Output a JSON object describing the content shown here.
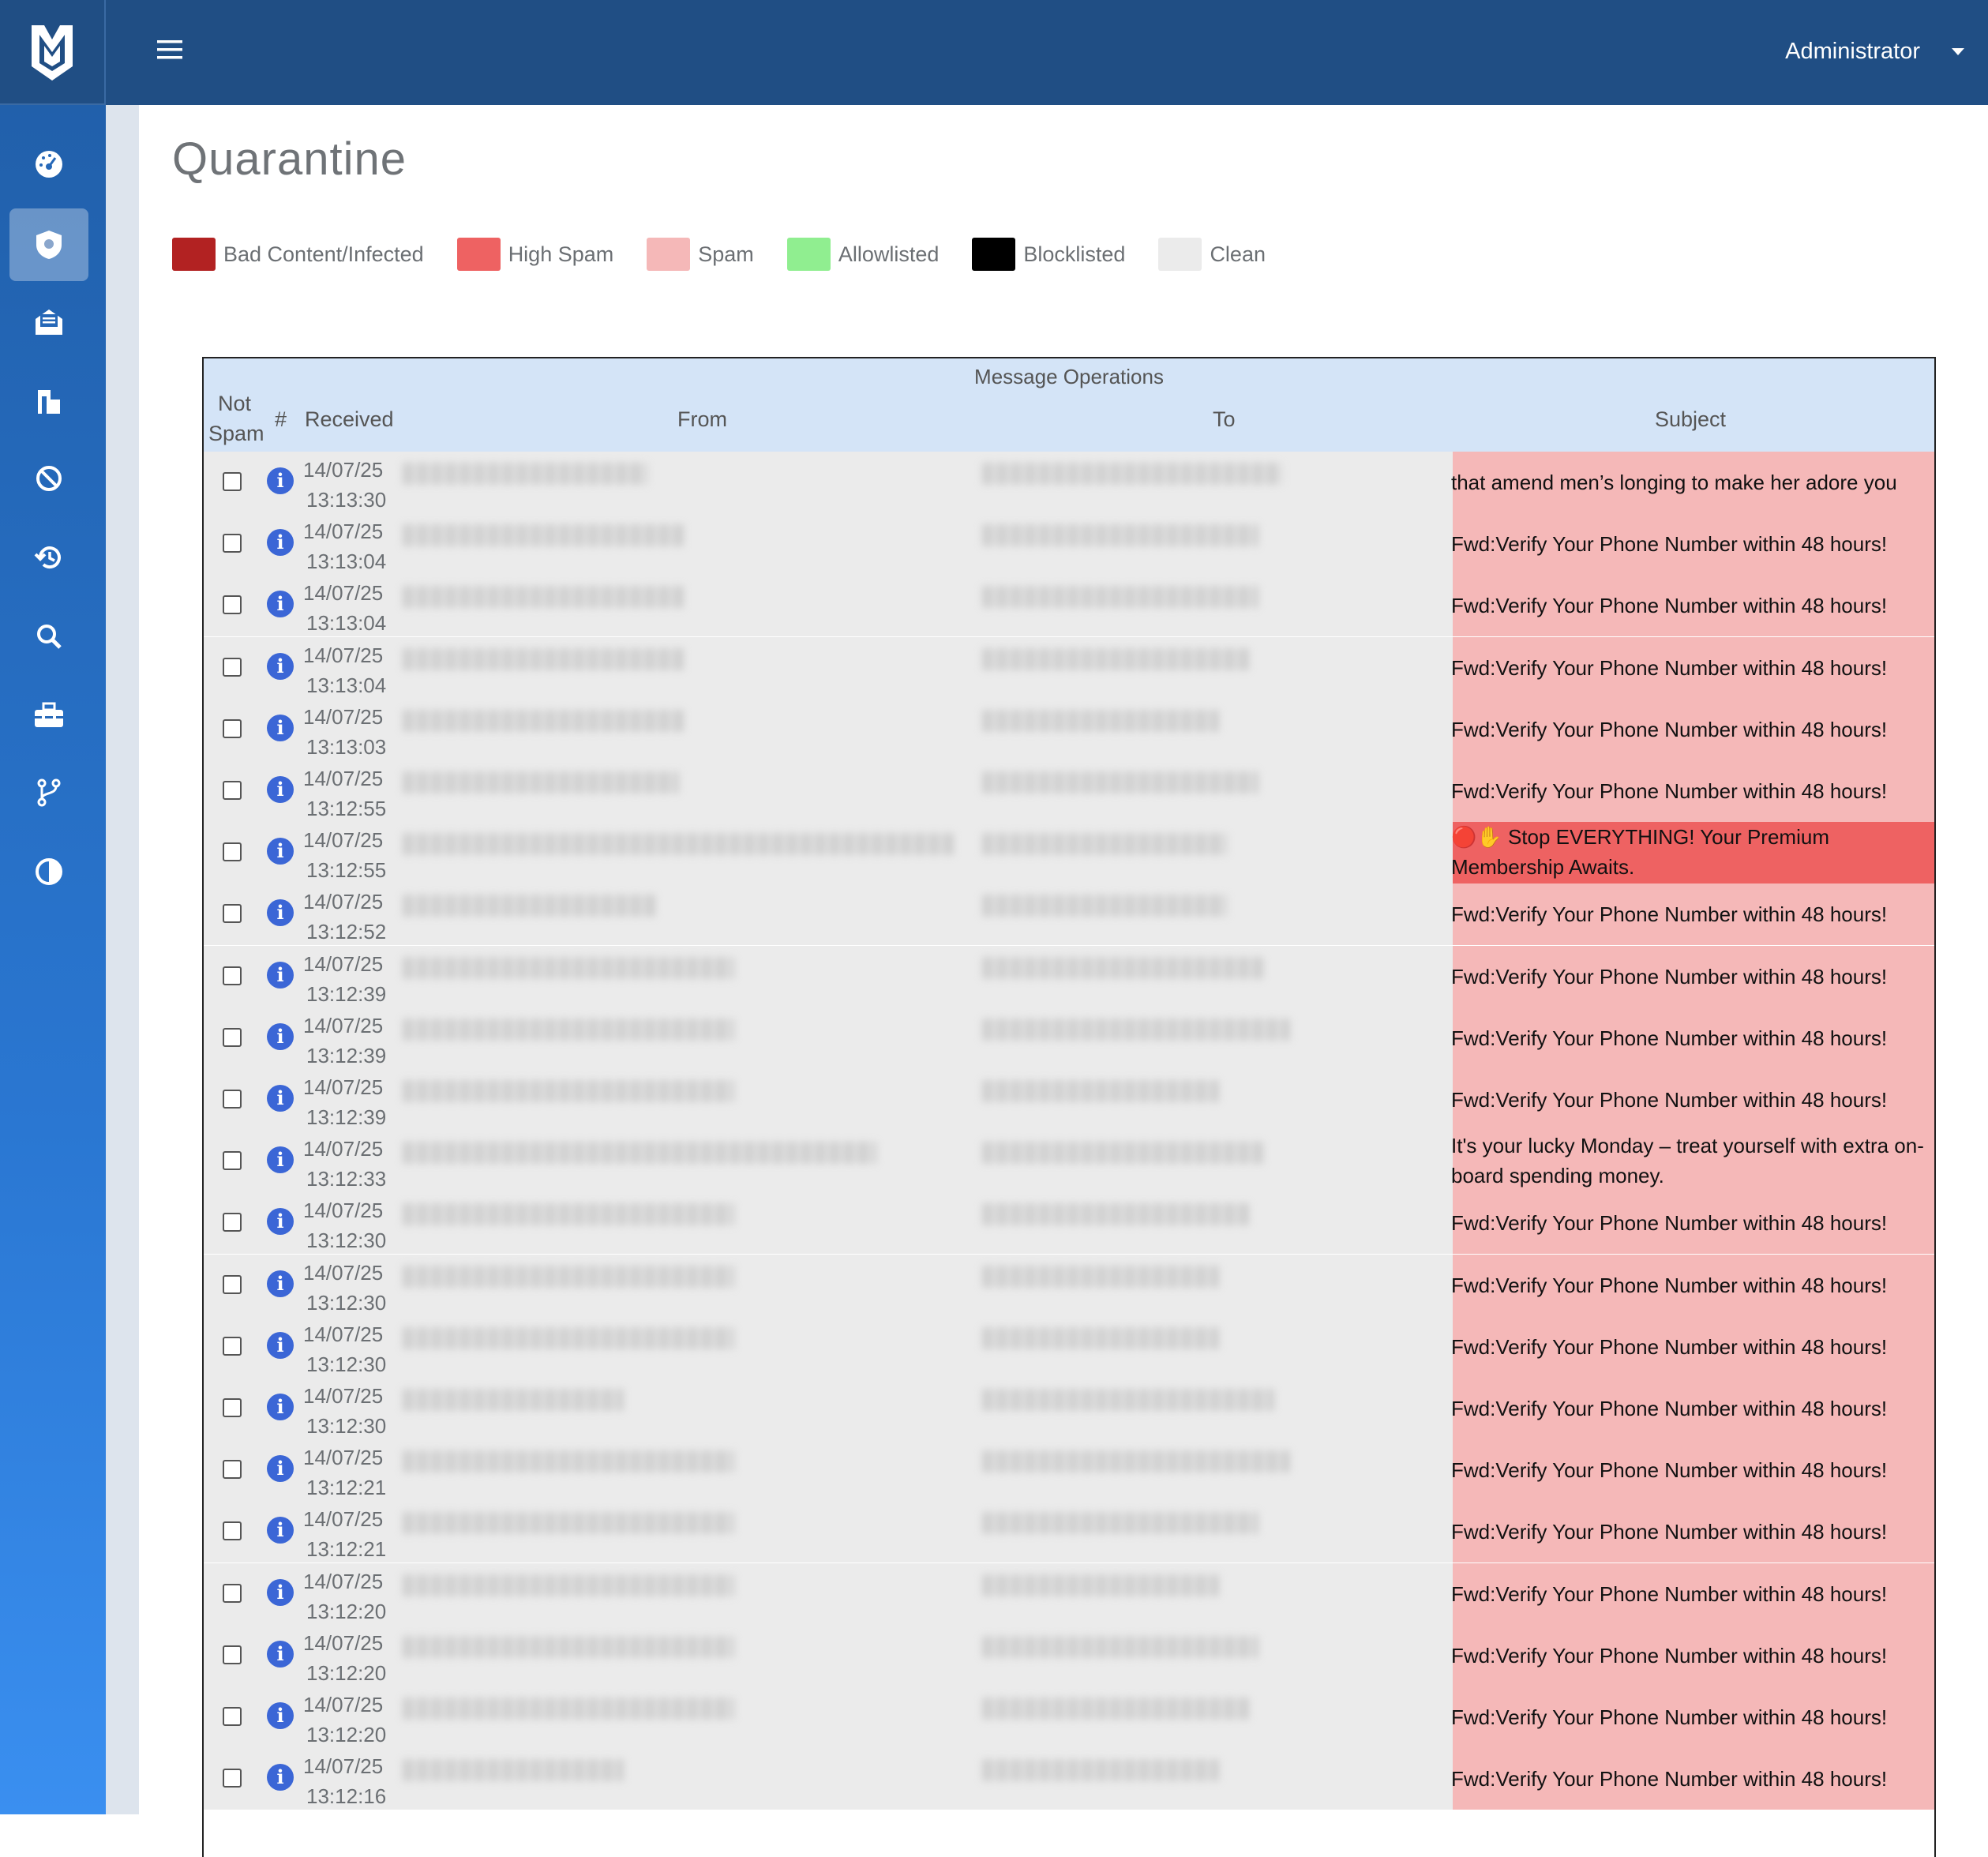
{
  "header": {
    "logo": "mailwatch-logo",
    "menu_icon": "hamburger-menu-icon",
    "user": "Administrator"
  },
  "sidebar": {
    "items": [
      {
        "icon": "dashboard-icon",
        "active": false
      },
      {
        "icon": "shield-icon",
        "active": true
      },
      {
        "icon": "mail-icon",
        "active": false
      },
      {
        "icon": "reports-icon",
        "active": false
      },
      {
        "icon": "block-icon",
        "active": false
      },
      {
        "icon": "history-icon",
        "active": false
      },
      {
        "icon": "search-icon",
        "active": false
      },
      {
        "icon": "toolbox-icon",
        "active": false
      },
      {
        "icon": "branch-icon",
        "active": false
      },
      {
        "icon": "contrast-icon",
        "active": false
      }
    ]
  },
  "page": {
    "title": "Quarantine"
  },
  "legend": [
    {
      "label": "Bad Content/Infected",
      "color": "#b22222"
    },
    {
      "label": "High Spam",
      "color": "#ee6262"
    },
    {
      "label": "Spam",
      "color": "#f5b8b8"
    },
    {
      "label": "Allowlisted",
      "color": "#90ee90"
    },
    {
      "label": "Blocklisted",
      "color": "#000000"
    },
    {
      "label": "Clean",
      "color": "#ebebeb"
    }
  ],
  "table": {
    "group_header": "Message Operations",
    "columns": {
      "not_spam_1": "Not",
      "not_spam_2": "Spam",
      "hash": "#",
      "received": "Received",
      "from": "From",
      "to": "To",
      "subject": "Subject"
    },
    "colors": {
      "spam": "#f5b8b8",
      "high_spam": "#ee6262"
    },
    "rows": [
      {
        "date": "14/07/25",
        "time": "13:13:30",
        "subject": "that amend men’s longing to make her adore you",
        "level": "spam"
      },
      {
        "date": "14/07/25",
        "time": "13:13:04",
        "subject": "Fwd:Verify Your Phone Number within 48 hours!",
        "level": "spam"
      },
      {
        "date": "14/07/25",
        "time": "13:13:04",
        "subject": "Fwd:Verify Your Phone Number within 48 hours!",
        "level": "spam"
      },
      {
        "date": "14/07/25",
        "time": "13:13:04",
        "subject": "Fwd:Verify Your Phone Number within 48 hours!",
        "level": "spam"
      },
      {
        "date": "14/07/25",
        "time": "13:13:03",
        "subject": "Fwd:Verify Your Phone Number within 48 hours!",
        "level": "spam"
      },
      {
        "date": "14/07/25",
        "time": "13:12:55",
        "subject": "Fwd:Verify Your Phone Number within 48 hours!",
        "level": "spam"
      },
      {
        "date": "14/07/25",
        "time": "13:12:55",
        "subject": "🔴✋ Stop EVERYTHING! Your Premium Membership Awaits.",
        "level": "high_spam"
      },
      {
        "date": "14/07/25",
        "time": "13:12:52",
        "subject": "Fwd:Verify Your Phone Number within 48 hours!",
        "level": "spam"
      },
      {
        "date": "14/07/25",
        "time": "13:12:39",
        "subject": "Fwd:Verify Your Phone Number within 48 hours!",
        "level": "spam"
      },
      {
        "date": "14/07/25",
        "time": "13:12:39",
        "subject": "Fwd:Verify Your Phone Number within 48 hours!",
        "level": "spam"
      },
      {
        "date": "14/07/25",
        "time": "13:12:39",
        "subject": "Fwd:Verify Your Phone Number within 48 hours!",
        "level": "spam"
      },
      {
        "date": "14/07/25",
        "time": "13:12:33",
        "subject": "It's your lucky Monday – treat yourself with extra on-board spending money.",
        "level": "spam"
      },
      {
        "date": "14/07/25",
        "time": "13:12:30",
        "subject": "Fwd:Verify Your Phone Number within 48 hours!",
        "level": "spam"
      },
      {
        "date": "14/07/25",
        "time": "13:12:30",
        "subject": "Fwd:Verify Your Phone Number within 48 hours!",
        "level": "spam"
      },
      {
        "date": "14/07/25",
        "time": "13:12:30",
        "subject": "Fwd:Verify Your Phone Number within 48 hours!",
        "level": "spam"
      },
      {
        "date": "14/07/25",
        "time": "13:12:30",
        "subject": "Fwd:Verify Your Phone Number within 48 hours!",
        "level": "spam"
      },
      {
        "date": "14/07/25",
        "time": "13:12:21",
        "subject": "Fwd:Verify Your Phone Number within 48 hours!",
        "level": "spam"
      },
      {
        "date": "14/07/25",
        "time": "13:12:21",
        "subject": "Fwd:Verify Your Phone Number within 48 hours!",
        "level": "spam"
      },
      {
        "date": "14/07/25",
        "time": "13:12:20",
        "subject": "Fwd:Verify Your Phone Number within 48 hours!",
        "level": "spam"
      },
      {
        "date": "14/07/25",
        "time": "13:12:20",
        "subject": "Fwd:Verify Your Phone Number within 48 hours!",
        "level": "spam"
      },
      {
        "date": "14/07/25",
        "time": "13:12:20",
        "subject": "Fwd:Verify Your Phone Number within 48 hours!",
        "level": "spam"
      },
      {
        "date": "14/07/25",
        "time": "13:12:16",
        "subject": "Fwd:Verify Your Phone Number within 48 hours!",
        "level": "spam"
      }
    ]
  }
}
